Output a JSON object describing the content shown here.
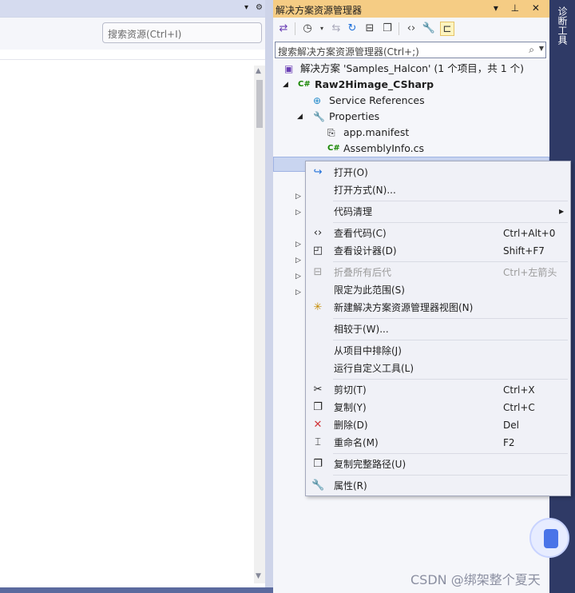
{
  "left_pane": {
    "search_placeholder": "搜索资源(Ctrl+I)",
    "title_buttons": [
      "▾",
      "⚙"
    ]
  },
  "solution_explorer": {
    "title": "解决方案资源管理器",
    "title_buttons": "▾ ⊥ ✕",
    "search_placeholder": "搜索解决方案资源管理器(Ctrl+;)",
    "toolbar_icons": [
      "vs-switch-view-icon",
      "history-icon",
      "sync-arrows-icon",
      "refresh-icon",
      "collapse-all-icon",
      "copy-view-icon",
      "code-view-icon",
      "wrench-icon",
      "preview-icon"
    ]
  },
  "tree": {
    "solution": "解决方案 'Samples_Halcon' (1 个项目，共 1 个)",
    "project": "Raw2Himage_CSharp",
    "service_references": "Service References",
    "properties": "Properties",
    "app_manifest": "app.manifest",
    "assembly_info": "AssemblyInfo.cs"
  },
  "side_strip": {
    "label": "诊断工具"
  },
  "context_menu": {
    "open": "打开(O)",
    "open_with": "打开方式(N)...",
    "code_cleanup": "代码清理",
    "view_code": "查看代码(C)",
    "view_code_key": "Ctrl+Alt+0",
    "view_designer": "查看设计器(D)",
    "view_designer_key": "Shift+F7",
    "collapse_descendants": "折叠所有后代",
    "collapse_descendants_key": "Ctrl+左箭头",
    "scope_to_this": "限定为此范围(S)",
    "new_view": "新建解决方案资源管理器视图(N)",
    "compare_with": "相较于(W)...",
    "exclude_from_project": "从项目中排除(J)",
    "run_custom_tool": "运行自定义工具(L)",
    "cut": "剪切(T)",
    "cut_key": "Ctrl+X",
    "copy": "复制(Y)",
    "copy_key": "Ctrl+C",
    "delete": "删除(D)",
    "delete_key": "Del",
    "rename": "重命名(M)",
    "rename_key": "F2",
    "copy_full_path": "复制完整路径(U)",
    "properties": "属性(R)"
  },
  "watermark": "CSDN @绑架整个夏天",
  "colors": {
    "title_accent": "#f5cc84",
    "side_strip": "#2f3a66",
    "selection": "#c9d5f0",
    "delete_icon": "#d13438"
  }
}
